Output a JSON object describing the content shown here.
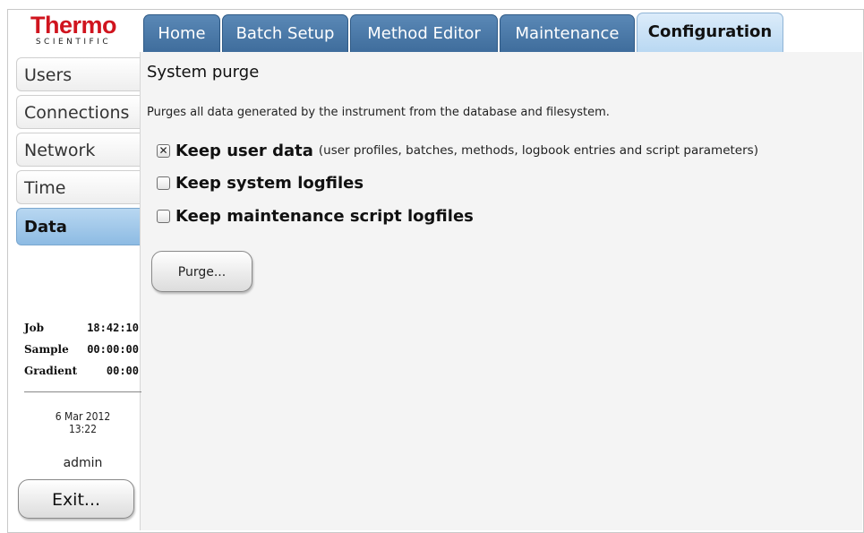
{
  "logo": {
    "brand": "Thermo",
    "sub": "SCIENTIFIC"
  },
  "tabs": [
    {
      "label": "Home",
      "active": false
    },
    {
      "label": "Batch Setup",
      "active": false
    },
    {
      "label": "Method Editor",
      "active": false
    },
    {
      "label": "Maintenance",
      "active": false
    },
    {
      "label": "Configuration",
      "active": true
    }
  ],
  "sidebar": {
    "items": [
      {
        "label": "Users",
        "active": false
      },
      {
        "label": "Connections",
        "active": false
      },
      {
        "label": "Network",
        "active": false
      },
      {
        "label": "Time",
        "active": false
      },
      {
        "label": "Data",
        "active": true
      }
    ],
    "status": [
      {
        "label": "Job",
        "value": "18:42:10"
      },
      {
        "label": "Sample",
        "value": "00:00:00"
      },
      {
        "label": "Gradient",
        "value": "00:00"
      }
    ],
    "date": "6 Mar 2012",
    "time": "13:22",
    "user": "admin",
    "exit_label": "Exit..."
  },
  "main": {
    "title": "System purge",
    "description": "Purges all data generated by the instrument from the database and filesystem.",
    "options": [
      {
        "label": "Keep user data",
        "hint": "(user profiles, batches, methods, logbook entries and script parameters)",
        "checked": true
      },
      {
        "label": "Keep system logfiles",
        "hint": "",
        "checked": false
      },
      {
        "label": "Keep maintenance script logfiles",
        "hint": "",
        "checked": false
      }
    ],
    "purge_label": "Purge..."
  },
  "colors": {
    "brand_red": "#d0141e",
    "tab_blue": "#4a78a8",
    "active_tab": "#c9e1f6",
    "active_side": "#a3c9ea"
  }
}
